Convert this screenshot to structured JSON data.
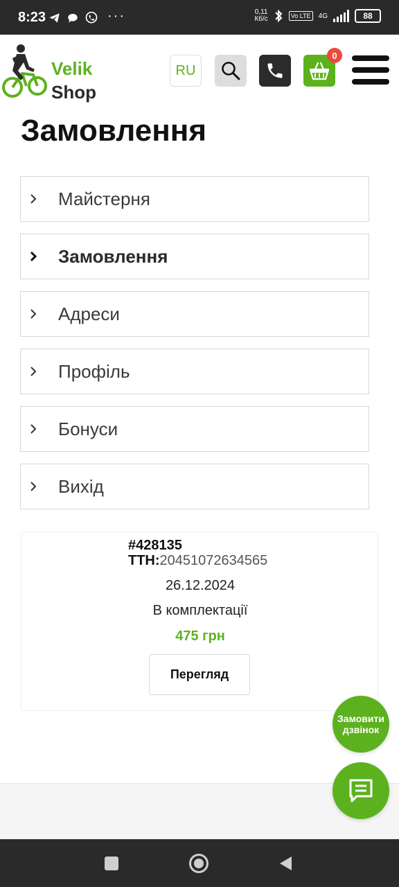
{
  "status_bar": {
    "time": "8:23",
    "net_speed_value": "0,11",
    "net_speed_unit": "Кб/с",
    "volte": "Vo LTE",
    "network": "4G",
    "battery": "88"
  },
  "header": {
    "logo_line1": "Velik",
    "logo_line2": "Shop",
    "lang_button": "RU",
    "cart_count": "0"
  },
  "page": {
    "title": "Замовлення"
  },
  "menu": {
    "items": [
      {
        "label": "Майстерня",
        "active": false
      },
      {
        "label": "Замовлення",
        "active": true
      },
      {
        "label": "Адреси",
        "active": false
      },
      {
        "label": "Профіль",
        "active": false
      },
      {
        "label": "Бонуси",
        "active": false
      },
      {
        "label": "Вихід",
        "active": false
      }
    ]
  },
  "order": {
    "number": "#428135",
    "ttn_label": "ТТН:",
    "ttn_value": "20451072634565",
    "date": "26.12.2024",
    "status": "В комплектації",
    "price": "475 грн",
    "view_button": "Перегляд"
  },
  "floating": {
    "call_line1": "Замовити",
    "call_line2": "дзвінок"
  },
  "colors": {
    "accent": "#5cb21e",
    "dark": "#2b2b2b",
    "badge": "#e94b3c"
  }
}
